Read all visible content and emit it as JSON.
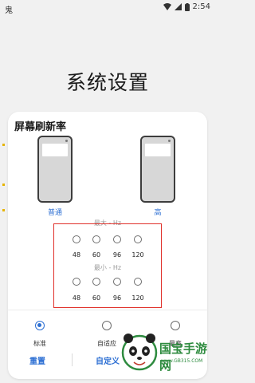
{
  "status_bar": {
    "left_icon": "鬼",
    "time": "2:54",
    "icons": [
      "wifi-icon",
      "signal-icon",
      "battery-icon"
    ]
  },
  "page": {
    "title": "系统设置"
  },
  "dialog": {
    "title": "屏幕刷新率",
    "previews": [
      {
        "label": "普通"
      },
      {
        "label": "高"
      }
    ],
    "max_section": {
      "label": "最大 - Hz",
      "options": [
        "48",
        "60",
        "96",
        "120"
      ]
    },
    "min_section": {
      "label": "最小 - Hz",
      "options": [
        "48",
        "60",
        "96",
        "120"
      ]
    },
    "modes": [
      {
        "label": "标准",
        "selected": true
      },
      {
        "label": "自适应",
        "selected": false
      },
      {
        "label": "最高",
        "selected": false
      }
    ],
    "buttons": {
      "reset": "重置",
      "custom": "自定义"
    }
  },
  "watermark": {
    "brand": "国宝手游网",
    "url": "www.GB315.COM"
  },
  "colors": {
    "accent": "#2d6fd3",
    "highlight": "#e0302a",
    "watermark": "#2e8b3f"
  }
}
